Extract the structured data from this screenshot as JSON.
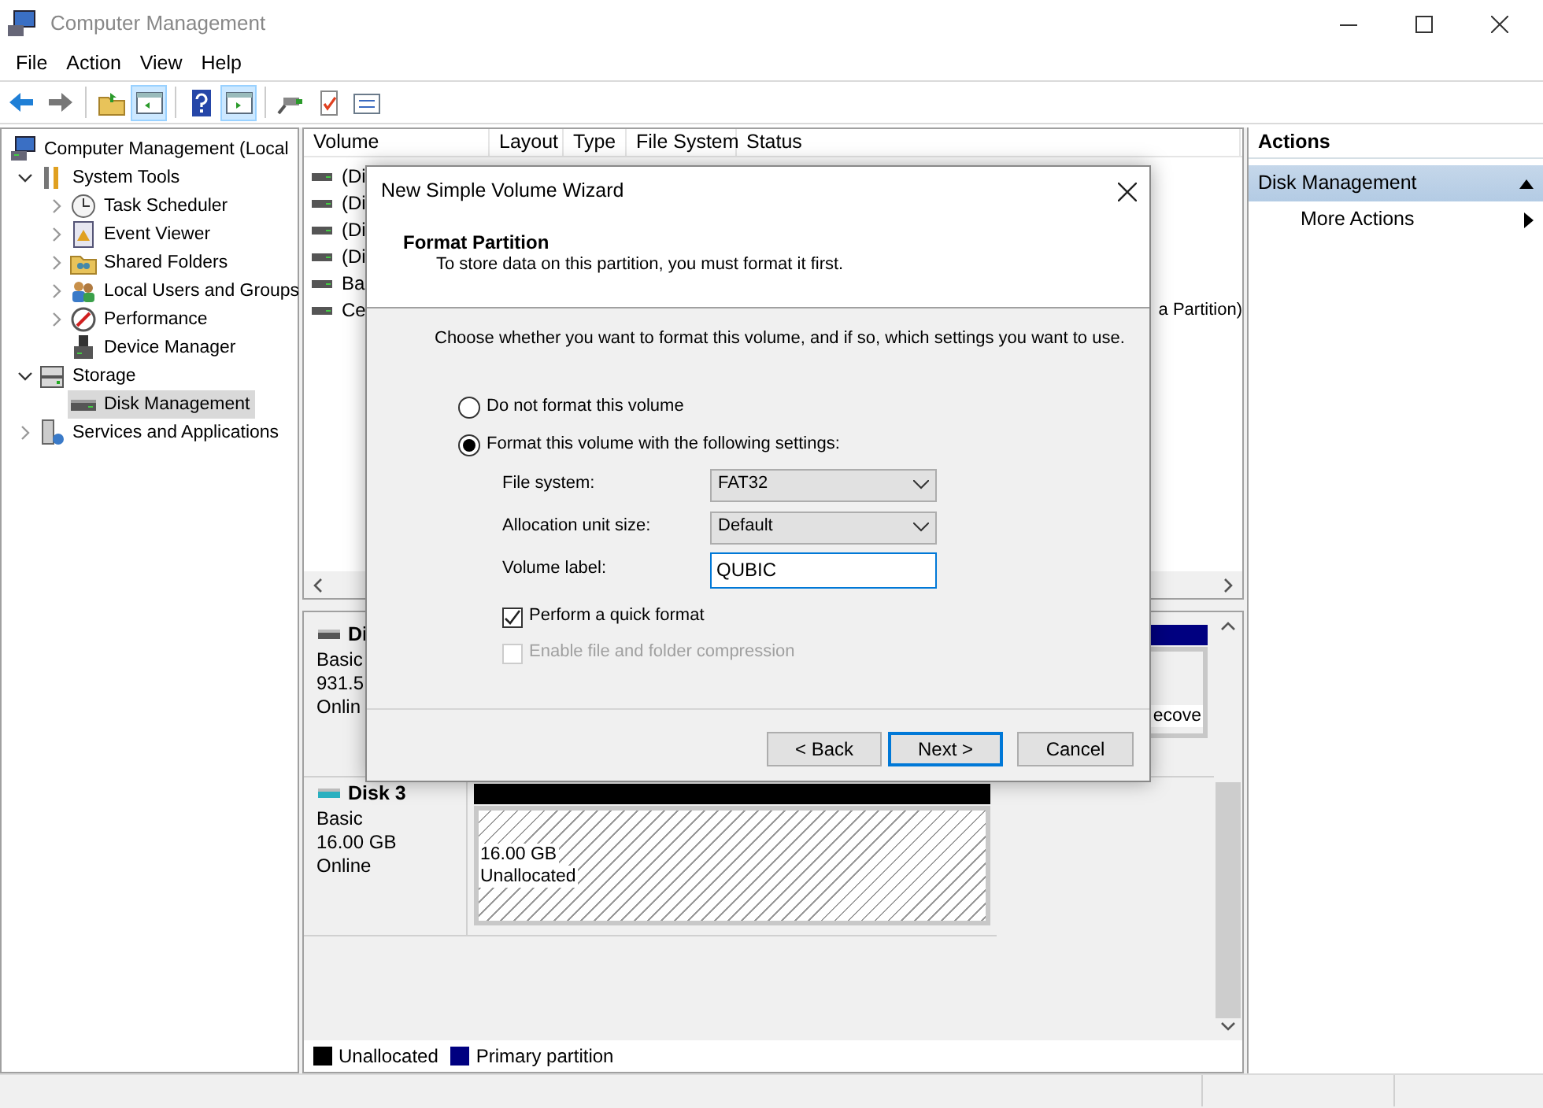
{
  "window": {
    "title": "Computer Management"
  },
  "menu": [
    "File",
    "Action",
    "View",
    "Help"
  ],
  "toolbar": [
    {
      "kind": "back",
      "pressed": false
    },
    {
      "kind": "forward",
      "pressed": false
    },
    {
      "kind": "separator"
    },
    {
      "kind": "up-folder",
      "pressed": false
    },
    {
      "kind": "tree-pane",
      "pressed": true
    },
    {
      "kind": "separator"
    },
    {
      "kind": "help",
      "pressed": false
    },
    {
      "kind": "action-pane",
      "pressed": true
    },
    {
      "kind": "separator"
    },
    {
      "kind": "connect",
      "pressed": false
    },
    {
      "kind": "checklist",
      "pressed": false
    },
    {
      "kind": "list",
      "pressed": false
    }
  ],
  "tree": [
    {
      "label": "Computer Management (Local",
      "kind": "computer",
      "selected": false,
      "children": [
        {
          "label": "System Tools",
          "kind": "tools",
          "expanded": true,
          "selected": false,
          "children": [
            {
              "label": "Task Scheduler",
              "kind": "clock",
              "expanded": false,
              "selected": false
            },
            {
              "label": "Event Viewer",
              "kind": "event",
              "expanded": false,
              "selected": false
            },
            {
              "label": "Shared Folders",
              "kind": "share",
              "expanded": false,
              "selected": false
            },
            {
              "label": "Local Users and Groups",
              "kind": "users",
              "expanded": false,
              "selected": false
            },
            {
              "label": "Performance",
              "kind": "perf",
              "expanded": false,
              "selected": false
            },
            {
              "label": "Device Manager",
              "kind": "device",
              "selected": false
            }
          ]
        },
        {
          "label": "Storage",
          "kind": "storage",
          "expanded": true,
          "selected": false,
          "children": [
            {
              "label": "Disk Management",
              "kind": "disk",
              "selected": true
            }
          ]
        },
        {
          "label": "Services and Applications",
          "kind": "services",
          "expanded": false,
          "selected": false
        }
      ]
    }
  ],
  "volume_list": {
    "columns": [
      "Volume",
      "Layout",
      "Type",
      "File System",
      "Status"
    ],
    "rows": [
      {
        "volume": "(Di"
      },
      {
        "volume": "(Di"
      },
      {
        "volume": "(Di"
      },
      {
        "volume": "(Di"
      },
      {
        "volume": "Ba"
      },
      {
        "volume": "Ce",
        "status": "a Partition)"
      }
    ]
  },
  "disks": [
    {
      "name": "Di",
      "type": "Basic",
      "size": "931.5",
      "state": "Onlin",
      "partitions": [
        {
          "kind": "primary",
          "lines": [
            "ecove"
          ]
        }
      ]
    },
    {
      "name": "Disk 3",
      "type": "Basic",
      "size": "16.00 GB",
      "state": "Online",
      "partitions": [
        {
          "kind": "unallocated",
          "lines": [
            "16.00 GB",
            "Unallocated"
          ]
        }
      ]
    }
  ],
  "legend": [
    {
      "label": "Unallocated",
      "color": "#000000"
    },
    {
      "label": "Primary partition",
      "color": "#000080"
    }
  ],
  "actions": {
    "title": "Actions",
    "groups": [
      {
        "label": "Disk Management",
        "expanded": true,
        "items": [
          "More Actions"
        ]
      }
    ]
  },
  "dialog": {
    "title": "New Simple Volume Wizard",
    "heading": "Format Partition",
    "subheading": "To store data on this partition, you must format it first.",
    "prompt": "Choose whether you want to format this volume, and if so, which settings you want to use.",
    "options": [
      {
        "label": "Do not format this volume",
        "selected": false
      },
      {
        "label": "Format this volume with the following settings:",
        "selected": true
      }
    ],
    "settings": [
      {
        "kind": "select",
        "label": "File system:",
        "value": "FAT32"
      },
      {
        "kind": "select",
        "label": "Allocation unit size:",
        "value": "Default"
      },
      {
        "kind": "text",
        "label": "Volume label:",
        "value": "QUBIC"
      }
    ],
    "checkboxes": [
      {
        "label": "Perform a quick format",
        "checked": true,
        "disabled": false
      },
      {
        "label": "Enable file and folder compression",
        "checked": false,
        "disabled": true
      }
    ],
    "buttons": [
      {
        "label": "< Back",
        "default": false
      },
      {
        "label": "Next >",
        "default": true
      },
      {
        "label": "Cancel",
        "default": false
      }
    ]
  }
}
